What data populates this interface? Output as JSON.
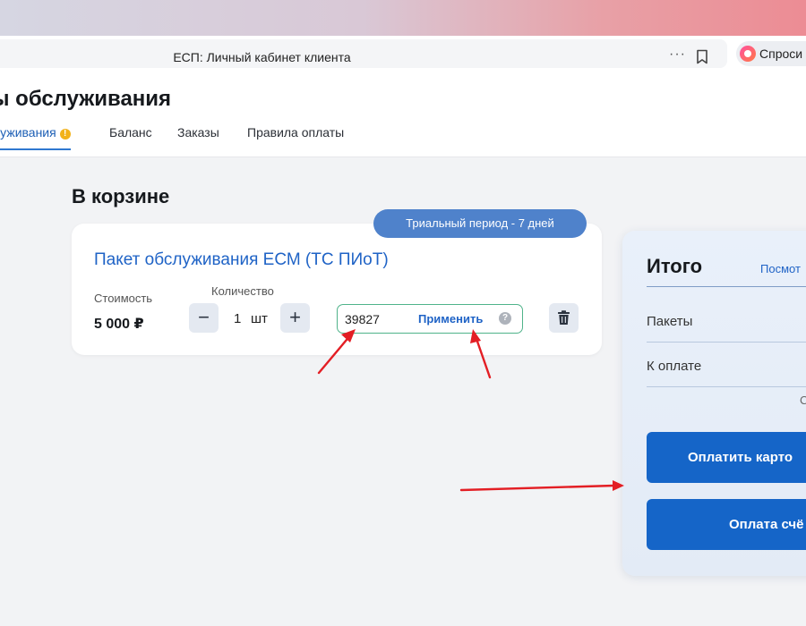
{
  "browser": {
    "tab_title": "ЕСП: Личный кабинет клиента",
    "menu_dots": "···",
    "ask_label": "Спроси"
  },
  "header": {
    "title": "ы обслуживания",
    "tabs": [
      {
        "label": "луживания"
      },
      {
        "label": "Баланс"
      },
      {
        "label": "Заказы"
      },
      {
        "label": "Правила оплаты"
      }
    ],
    "warning_mark": "!"
  },
  "cart": {
    "title": "В корзине",
    "badge": "Триальный период - 7 дней",
    "product": "Пакет обслуживания ЕСМ (ТС ПИоТ)",
    "cost_label": "Стоимость",
    "cost_value": "5 000 ₽",
    "qty_label": "Количество",
    "qty_minus": "−",
    "qty_value": "1",
    "qty_unit": "шт",
    "qty_plus": "+",
    "promo_value": "39827",
    "promo_apply": "Применить",
    "help_mark": "?"
  },
  "summary": {
    "title": "Итого",
    "link": "Посмот",
    "packets_label": "Пакеты",
    "topay_label": "К оплате",
    "cut_char": "С",
    "pay_card": "Оплатить карто",
    "pay_invoice": "Оплата счё"
  },
  "colors": {
    "accent": "#1565c8",
    "badge": "#4f82cb",
    "promo_border": "#4fb38a",
    "arrow": "#e31e24"
  }
}
